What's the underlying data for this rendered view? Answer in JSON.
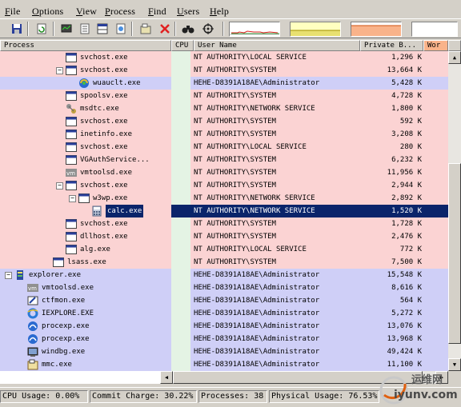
{
  "menu": [
    "File",
    "Options",
    "View",
    "Process",
    "Find",
    "Users",
    "Help"
  ],
  "columns": {
    "process": "Process",
    "cpu": "CPU",
    "user": "User Name",
    "private": "Private B...",
    "wo": "Wor"
  },
  "rows": [
    {
      "name": "svchost.exe",
      "user": "NT AUTHORITY\\LOCAL SERVICE",
      "private": "1,296 K",
      "type": "svc",
      "icon": "service-window-icon"
    },
    {
      "name": "svchost.exe",
      "user": "NT AUTHORITY\\SYSTEM",
      "private": "13,664 K",
      "type": "svc",
      "icon": "service-window-icon"
    },
    {
      "name": "wuauclt.exe",
      "user": "HEHE-D8391A18AE\\Administrator",
      "private": "5,428 K",
      "type": "user",
      "icon": "windows-update-icon"
    },
    {
      "name": "spoolsv.exe",
      "user": "NT AUTHORITY\\SYSTEM",
      "private": "4,728 K",
      "type": "svc",
      "icon": "service-window-icon"
    },
    {
      "name": "msdtc.exe",
      "user": "NT AUTHORITY\\NETWORK SERVICE",
      "private": "1,800 K",
      "type": "svc",
      "icon": "msdtc-icon"
    },
    {
      "name": "svchost.exe",
      "user": "NT AUTHORITY\\SYSTEM",
      "private": "592 K",
      "type": "svc",
      "icon": "service-window-icon"
    },
    {
      "name": "inetinfo.exe",
      "user": "NT AUTHORITY\\SYSTEM",
      "private": "3,208 K",
      "type": "svc",
      "icon": "service-window-icon"
    },
    {
      "name": "svchost.exe",
      "user": "NT AUTHORITY\\LOCAL SERVICE",
      "private": "280 K",
      "type": "svc",
      "icon": "service-window-icon"
    },
    {
      "name": "VGAuthService...",
      "user": "NT AUTHORITY\\SYSTEM",
      "private": "6,232 K",
      "type": "svc",
      "icon": "service-window-icon"
    },
    {
      "name": "vmtoolsd.exe",
      "user": "NT AUTHORITY\\SYSTEM",
      "private": "11,956 K",
      "type": "svc",
      "icon": "vmware-icon"
    },
    {
      "name": "svchost.exe",
      "user": "NT AUTHORITY\\SYSTEM",
      "private": "2,944 K",
      "type": "svc",
      "icon": "service-window-icon"
    },
    {
      "name": "w3wp.exe",
      "user": "NT AUTHORITY\\NETWORK SERVICE",
      "private": "2,892 K",
      "type": "svc",
      "icon": "service-window-icon"
    },
    {
      "name": "calc.exe",
      "user": "NT AUTHORITY\\NETWORK SERVICE",
      "private": "1,520 K",
      "type": "sel",
      "icon": "calculator-icon"
    },
    {
      "name": "svchost.exe",
      "user": "NT AUTHORITY\\SYSTEM",
      "private": "1,728 K",
      "type": "svc",
      "icon": "service-window-icon"
    },
    {
      "name": "dllhost.exe",
      "user": "NT AUTHORITY\\SYSTEM",
      "private": "2,476 K",
      "type": "svc",
      "icon": "service-window-icon"
    },
    {
      "name": "alg.exe",
      "user": "NT AUTHORITY\\LOCAL SERVICE",
      "private": "772 K",
      "type": "svc",
      "icon": "service-window-icon"
    },
    {
      "name": "lsass.exe",
      "user": "NT AUTHORITY\\SYSTEM",
      "private": "7,500 K",
      "type": "svc",
      "icon": "service-window-icon"
    },
    {
      "name": "explorer.exe",
      "user": "HEHE-D8391A18AE\\Administrator",
      "private": "15,548 K",
      "type": "user",
      "icon": "explorer-icon"
    },
    {
      "name": "vmtoolsd.exe",
      "user": "HEHE-D8391A18AE\\Administrator",
      "private": "8,616 K",
      "type": "user",
      "icon": "vmware-icon"
    },
    {
      "name": "ctfmon.exe",
      "user": "HEHE-D8391A18AE\\Administrator",
      "private": "564 K",
      "type": "user",
      "icon": "ctfmon-icon"
    },
    {
      "name": "IEXPLORE.EXE",
      "user": "HEHE-D8391A18AE\\Administrator",
      "private": "5,272 K",
      "type": "user",
      "icon": "internet-explorer-icon"
    },
    {
      "name": "procexp.exe",
      "user": "HEHE-D8391A18AE\\Administrator",
      "private": "13,076 K",
      "type": "user",
      "icon": "process-explorer-icon"
    },
    {
      "name": "procexp.exe",
      "user": "HEHE-D8391A18AE\\Administrator",
      "private": "13,968 K",
      "type": "user",
      "icon": "process-explorer-icon"
    },
    {
      "name": "windbg.exe",
      "user": "HEHE-D8391A18AE\\Administrator",
      "private": "49,424 K",
      "type": "user",
      "icon": "windbg-icon"
    },
    {
      "name": "mmc.exe",
      "user": "HEHE-D8391A18AE\\Administrator",
      "private": "11,100 K",
      "type": "user",
      "icon": "mmc-icon"
    }
  ],
  "status": {
    "cpu": "CPU Usage: 0.00%",
    "commit": "Commit Charge: 30.22%",
    "processes": "Processes: 38",
    "physical": "Physical Usage: 76.53%"
  },
  "watermark": {
    "cn": "运维网",
    "url": "iyunv.com"
  },
  "colors": {
    "service_row": "#fbd3d3",
    "user_row": "#cfcff7",
    "selected_row": "#0a246a",
    "cpu_column": "#e4f3e4"
  }
}
